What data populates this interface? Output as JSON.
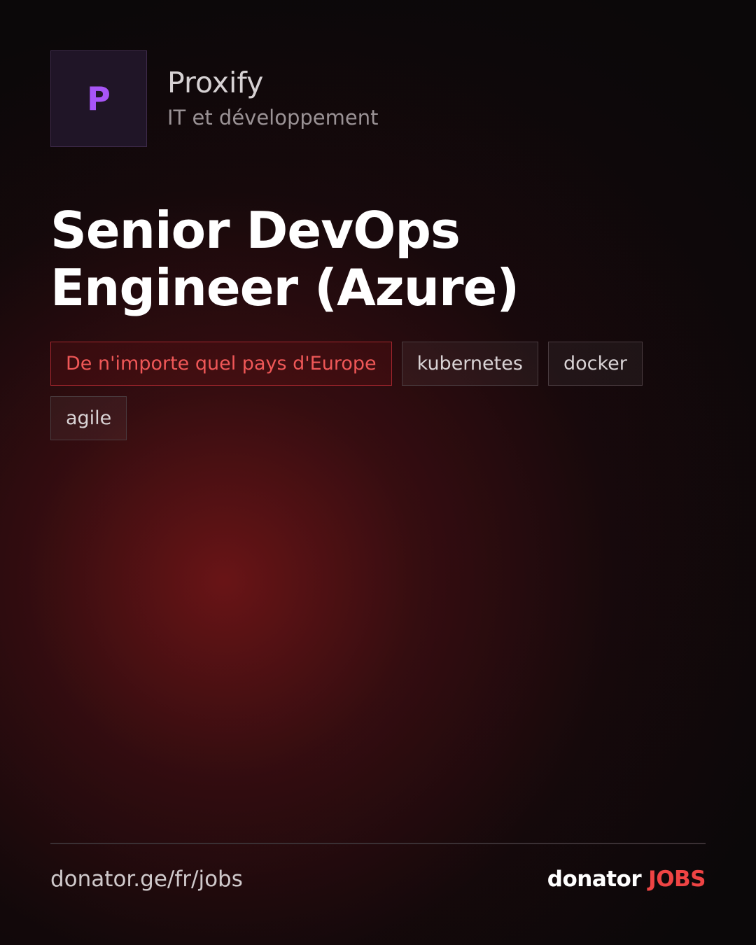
{
  "company": {
    "logo_letter": "P",
    "name": "Proxify",
    "category": "IT et développement"
  },
  "job": {
    "title": "Senior DevOps Engineer (Azure)"
  },
  "tags": {
    "location": "De n'importe quel pays d'Europe",
    "skills": [
      "kubernetes",
      "docker",
      "agile"
    ]
  },
  "footer": {
    "url": "donator.ge/fr/jobs",
    "brand_main": "donator",
    "brand_accent": "JOBS"
  },
  "colors": {
    "accent_red": "#ef4444",
    "logo_purple": "#a855f7",
    "background": "#0b0809"
  }
}
